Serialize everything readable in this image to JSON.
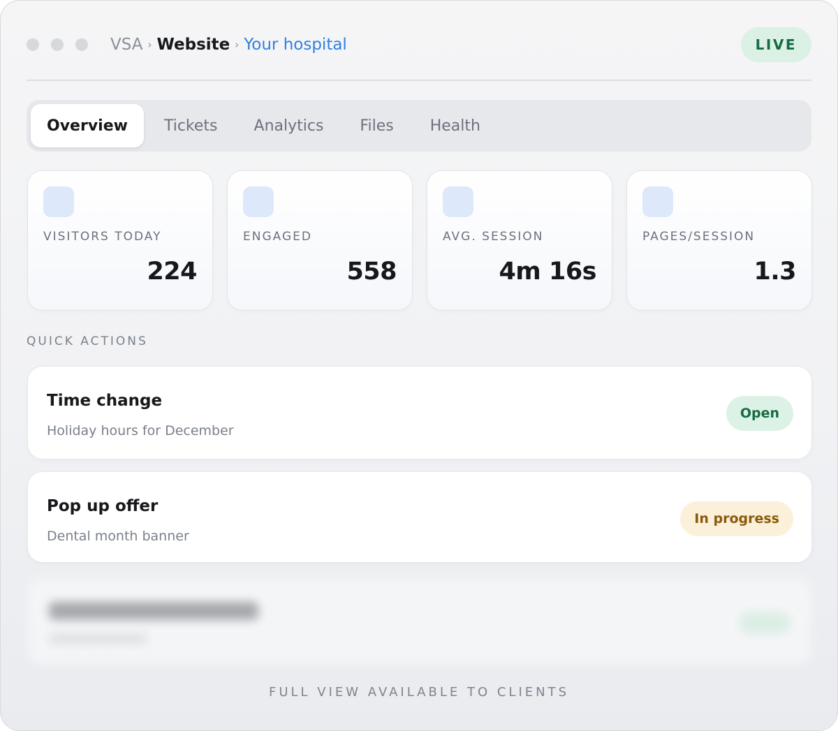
{
  "breadcrumb": {
    "root": "VSA",
    "section": "Website",
    "current": "Your hospital"
  },
  "status_pill": "LIVE",
  "tabs": [
    {
      "label": "Overview",
      "active": true
    },
    {
      "label": "Tickets",
      "active": false
    },
    {
      "label": "Analytics",
      "active": false
    },
    {
      "label": "Files",
      "active": false
    },
    {
      "label": "Health",
      "active": false
    }
  ],
  "stats": [
    {
      "label": "VISITORS TODAY",
      "value": "224"
    },
    {
      "label": "ENGAGED",
      "value": "558"
    },
    {
      "label": "AVG. SESSION",
      "value": "4m 16s"
    },
    {
      "label": "PAGES/SESSION",
      "value": "1.3"
    }
  ],
  "quick_actions": {
    "heading": "QUICK ACTIONS",
    "items": [
      {
        "title": "Time change",
        "subtitle": "Holiday hours for December",
        "status": "Open"
      },
      {
        "title": "Pop up offer",
        "subtitle": "Dental month banner",
        "status": "In progress"
      }
    ]
  },
  "footer_note": "FULL VIEW AVAILABLE TO CLIENTS",
  "colors": {
    "accent_link": "#2f7fe0",
    "live_green": "#146c43",
    "open_bg": "#ddf2e6",
    "progress_bg": "#fbf0d9",
    "progress_text": "#8a5a0c"
  }
}
